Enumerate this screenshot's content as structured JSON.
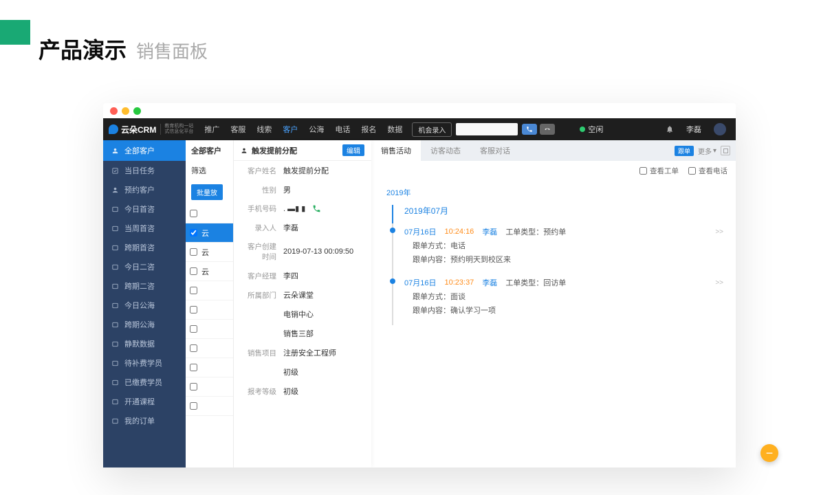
{
  "slide": {
    "main": "产品演示",
    "sub": "销售面板"
  },
  "topnav": {
    "items": [
      "推广",
      "客服",
      "线索",
      "客户",
      "公海",
      "电话",
      "报名",
      "数据"
    ],
    "active_index": 3,
    "pill": "机会录入"
  },
  "status": {
    "label": "空闲"
  },
  "user": "李磊",
  "sidebar": {
    "head": "全部客户",
    "items": [
      "当日任务",
      "预约客户",
      "今日首咨",
      "当周首咨",
      "跨期首咨",
      "今日二咨",
      "跨期二咨",
      "今日公海",
      "跨期公海",
      "静默数据",
      "待补费学员",
      "已缴费学员",
      "开通课程",
      "我的订单"
    ]
  },
  "list": {
    "head": "全部客户",
    "filter": "筛选",
    "batch": "批量放",
    "rows": [
      "",
      "云",
      "云",
      "云",
      "",
      "",
      "",
      "",
      "",
      "",
      ""
    ]
  },
  "detail": {
    "title": "触发提前分配",
    "edit": "编辑",
    "fields": {
      "name_label": "客户姓名",
      "name": "触发提前分配",
      "gender_label": "性别",
      "gender": "男",
      "phone_label": "手机号码",
      "phone": ". ▬▮ ▮",
      "entry_label": "录入人",
      "entry": "李磊",
      "ctime_label": "客户创建时间",
      "ctime": "2019-07-13 00:09:50",
      "mgr_label": "客户经理",
      "mgr": "李四",
      "dept_label": "所属部门",
      "dept": "云朵课堂",
      "dept2": "电销中心",
      "dept3": "销售三部",
      "proj_label": "销售项目",
      "proj": "注册安全工程师",
      "proj2": "初级",
      "level_label": "报考等级",
      "level": "初级"
    }
  },
  "activity": {
    "tabs": [
      "销售活动",
      "访客动态",
      "客服对话"
    ],
    "follow": "跟单",
    "more": "更多",
    "filter1": "查看工单",
    "filter2": "查看电话",
    "year": "2019年",
    "month": "2019年07月",
    "entries": [
      {
        "date": "07月16日",
        "time": "10:24:16",
        "user": "李磊",
        "type": "工单类型：预约单",
        "lines": [
          "跟单方式：电话",
          "跟单内容：预约明天到校区来"
        ]
      },
      {
        "date": "07月16日",
        "time": "10:23:37",
        "user": "李磊",
        "type": "工单类型：回访单",
        "lines": [
          "跟单方式：面谈",
          "跟单内容：确认学习一项"
        ]
      }
    ]
  }
}
